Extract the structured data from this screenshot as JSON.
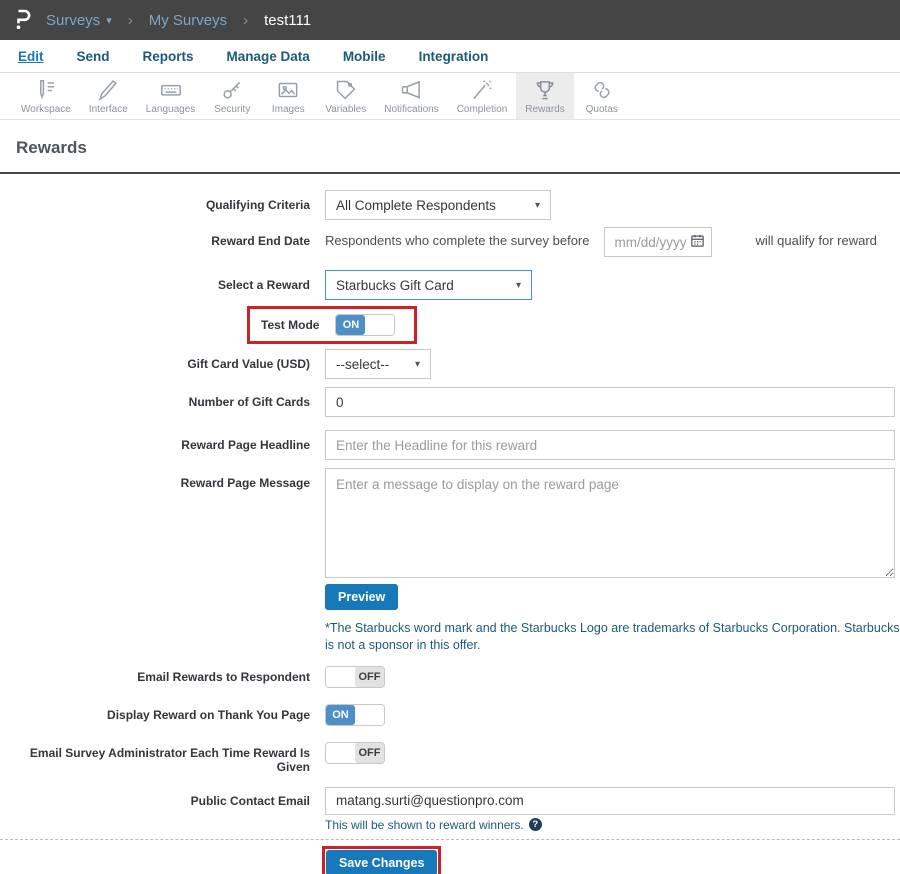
{
  "header": {
    "breadcrumb": [
      {
        "label": "Surveys"
      },
      {
        "label": "My Surveys"
      },
      {
        "label": "test111"
      }
    ]
  },
  "icons": {
    "caret_down": "▾",
    "chevron": "›",
    "question_mark": "?"
  },
  "nav": {
    "items": [
      {
        "label": "Edit",
        "active": true
      },
      {
        "label": "Send"
      },
      {
        "label": "Reports"
      },
      {
        "label": "Manage Data"
      },
      {
        "label": "Mobile"
      },
      {
        "label": "Integration"
      }
    ]
  },
  "toolbar": {
    "items": [
      {
        "label": "Workspace",
        "icon": "pencil-lines"
      },
      {
        "label": "Interface",
        "icon": "pen"
      },
      {
        "label": "Languages",
        "icon": "keyboard"
      },
      {
        "label": "Security",
        "icon": "key"
      },
      {
        "label": "Images",
        "icon": "picture"
      },
      {
        "label": "Variables",
        "icon": "tag"
      },
      {
        "label": "Notifications",
        "icon": "megaphone"
      },
      {
        "label": "Completion",
        "icon": "magic-wand"
      },
      {
        "label": "Rewards",
        "icon": "trophy",
        "active": true
      },
      {
        "label": "Quotas",
        "icon": "chain-links"
      }
    ]
  },
  "page": {
    "title": "Rewards"
  },
  "form": {
    "qualifying_criteria": {
      "label": "Qualifying Criteria",
      "value": "All Complete Respondents"
    },
    "reward_end_date": {
      "label": "Reward End Date",
      "prefix": "Respondents who complete the survey before",
      "placeholder": "mm/dd/yyyy",
      "suffix": "will qualify for reward"
    },
    "select_reward": {
      "label": "Select a Reward",
      "value": "Starbucks Gift Card"
    },
    "test_mode": {
      "label": "Test Mode",
      "state": "ON"
    },
    "gift_card_value": {
      "label": "Gift Card Value (USD)",
      "value": "--select--"
    },
    "number_of_gift_cards": {
      "label": "Number of Gift Cards",
      "value": "0"
    },
    "reward_page_headline": {
      "label": "Reward Page Headline",
      "placeholder": "Enter the Headline for this reward"
    },
    "reward_page_message": {
      "label": "Reward Page Message",
      "placeholder": "Enter a message to display on the reward page"
    },
    "preview_label": "Preview",
    "disclaimer": "*The Starbucks word mark and the Starbucks Logo are trademarks of Starbucks Corporation. Starbucks is not a sponsor in this offer.",
    "email_rewards": {
      "label": "Email Rewards to Respondent",
      "state": "OFF"
    },
    "display_reward": {
      "label": "Display Reward on Thank You Page",
      "state": "ON"
    },
    "email_admin": {
      "label": "Email Survey Administrator Each Time Reward Is Given",
      "state": "OFF"
    },
    "public_contact_email": {
      "label": "Public Contact Email",
      "value": "matang.surti@questionpro.com",
      "helper": "This will be shown to reward winners."
    },
    "save_label": "Save Changes"
  },
  "colors": {
    "header_bg": "#454545",
    "accent_blue": "#1779ba",
    "toggle_on_blue": "#4e8fc7",
    "nav_text": "#1d5a77",
    "annotation_red": "#cc2127"
  }
}
